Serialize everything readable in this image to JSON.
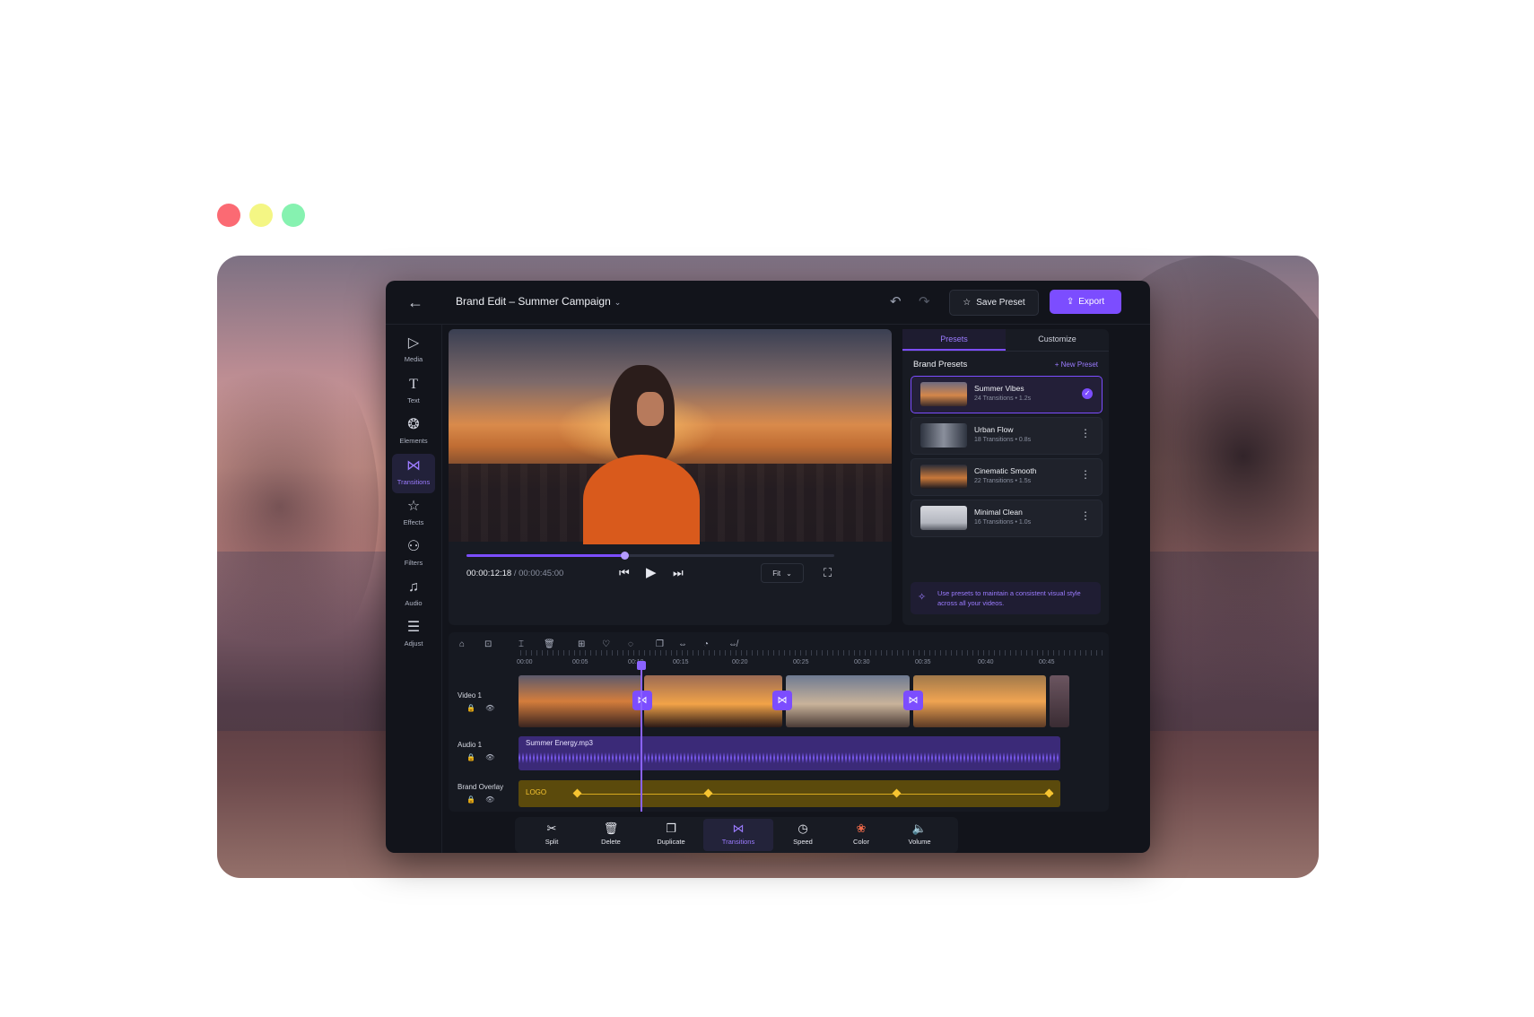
{
  "window_dots": [
    "red",
    "yellow",
    "green"
  ],
  "colors": {
    "accent": "#7c4dff",
    "overlay": "#f6c431",
    "bg": "#12141b"
  },
  "header": {
    "title": "Brand Edit – Summer Campaign",
    "save_label": "Save Preset",
    "export_label": "Export"
  },
  "sidebar": {
    "items": [
      {
        "label": "Media",
        "icon": "media-icon",
        "active": false
      },
      {
        "label": "Text",
        "icon": "text-icon",
        "active": false
      },
      {
        "label": "Elements",
        "icon": "elements-icon",
        "active": false
      },
      {
        "label": "Transitions",
        "icon": "transitions-icon",
        "active": true
      },
      {
        "label": "Effects",
        "icon": "star-icon",
        "active": false
      },
      {
        "label": "Filters",
        "icon": "filters-icon",
        "active": false
      },
      {
        "label": "Audio",
        "icon": "music-icon",
        "active": false
      },
      {
        "label": "Adjust",
        "icon": "sliders-icon",
        "active": false
      }
    ]
  },
  "player": {
    "current_time": "00:00:12:18",
    "total_time": "00:00:45:00",
    "progress": 0.43,
    "fit_label": "Fit"
  },
  "panel": {
    "tabs": [
      "Presets",
      "Customize"
    ],
    "active_tab": "Presets",
    "heading": "Brand Presets",
    "new_label": "+ New Preset",
    "presets": [
      {
        "name": "Summer Vibes",
        "meta": "24 Transitions • 1.2s",
        "selected": true
      },
      {
        "name": "Urban Flow",
        "meta": "18 Transitions • 0.8s",
        "selected": false
      },
      {
        "name": "Cinematic Smooth",
        "meta": "22 Transitions • 1.5s",
        "selected": false
      },
      {
        "name": "Minimal Clean",
        "meta": "16 Transitions • 1.0s",
        "selected": false
      }
    ],
    "tip": "Use presets to maintain a consistent visual style across all your videos."
  },
  "timeline": {
    "ticks": [
      "00:00",
      "00:05",
      "00:10",
      "00:15",
      "00:20",
      "00:25",
      "00:30",
      "00:35",
      "00:40",
      "00:45"
    ],
    "tracks": [
      {
        "label": "Video 1"
      },
      {
        "label": "Audio 1"
      },
      {
        "label": "Brand Overlay"
      }
    ],
    "audio_name": "Summer Energy.mp3",
    "overlay_name": "LOGO"
  },
  "bottom_toolbar": [
    {
      "label": "Split",
      "icon": "scissors-icon",
      "active": false
    },
    {
      "label": "Delete",
      "icon": "trash-icon",
      "active": false
    },
    {
      "label": "Duplicate",
      "icon": "duplicate-icon",
      "active": false
    },
    {
      "label": "Transitions",
      "icon": "transitions-icon",
      "active": true
    },
    {
      "label": "Speed",
      "icon": "speed-icon",
      "active": false
    },
    {
      "label": "Color",
      "icon": "color-icon",
      "active": false
    },
    {
      "label": "Volume",
      "icon": "volume-icon",
      "active": false
    }
  ]
}
